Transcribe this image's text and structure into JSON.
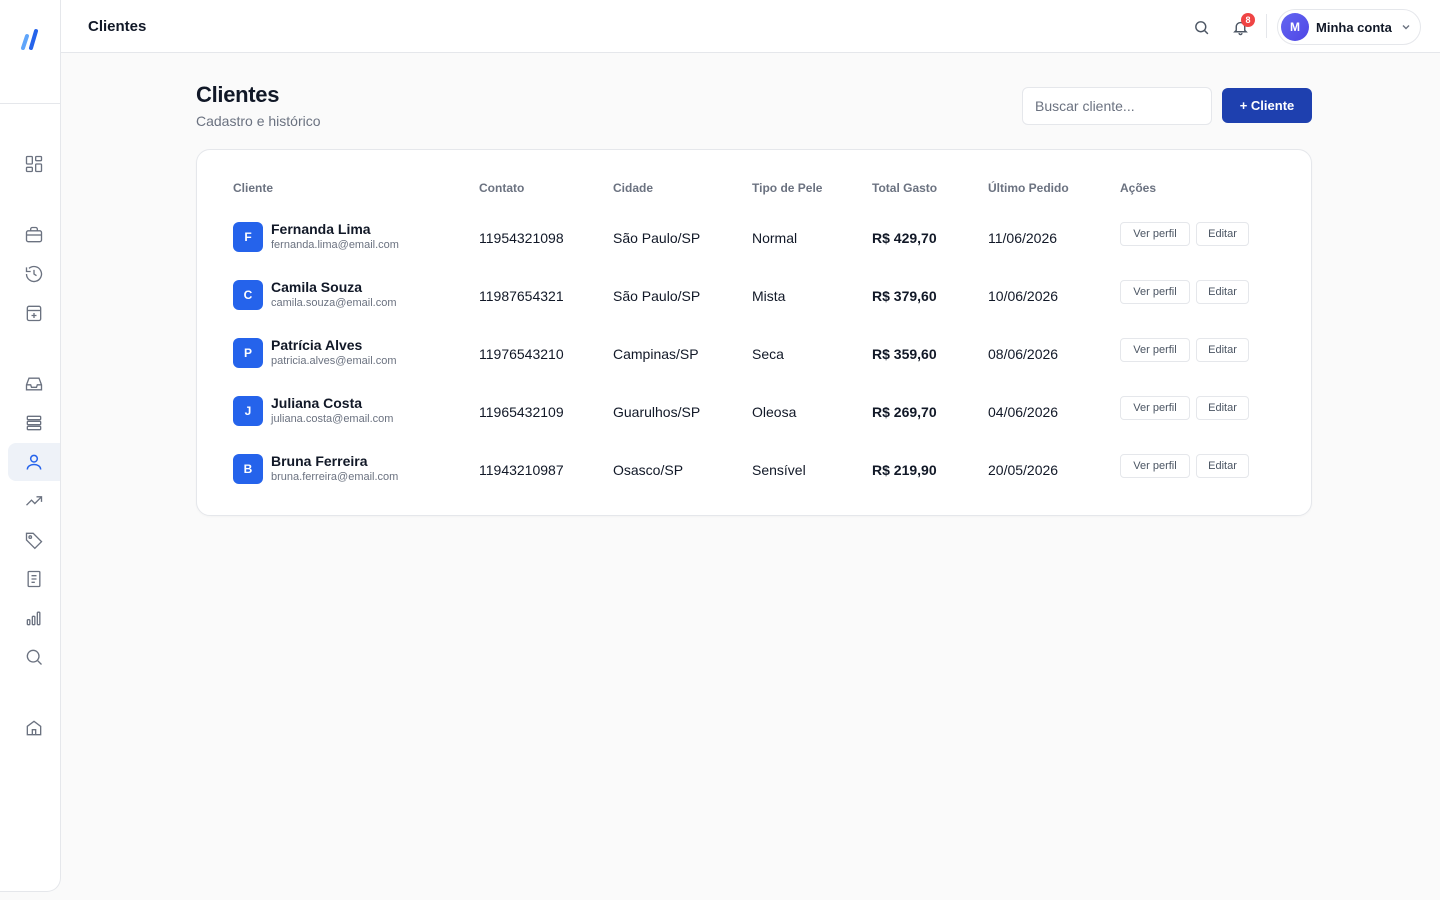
{
  "topbar": {
    "title": "Clientes",
    "notifications_count": "8",
    "account": {
      "initial": "M",
      "label": "Minha conta"
    }
  },
  "sidebar": {
    "logo": "logo-icon",
    "items": [
      {
        "icon": "dashboard-icon",
        "active": false
      },
      {
        "icon": "briefcase-icon",
        "active": false
      },
      {
        "icon": "history-icon",
        "active": false
      },
      {
        "icon": "archive-plus-icon",
        "active": false
      },
      {
        "icon": "inbox-icon",
        "active": false
      },
      {
        "icon": "layers-icon",
        "active": false
      },
      {
        "icon": "user-icon",
        "active": true
      },
      {
        "icon": "trending-up-icon",
        "active": false
      },
      {
        "icon": "tag-icon",
        "active": false
      },
      {
        "icon": "document-icon",
        "active": false
      },
      {
        "icon": "bar-chart-icon",
        "active": false
      },
      {
        "icon": "search-icon",
        "active": false
      },
      {
        "icon": "home-icon",
        "active": false
      }
    ]
  },
  "page": {
    "title": "Clientes",
    "subtitle": "Cadastro e histórico",
    "search_placeholder": "Buscar cliente...",
    "add_button": "+ Cliente"
  },
  "table": {
    "columns": [
      "Cliente",
      "Contato",
      "Cidade",
      "Tipo de Pele",
      "Total Gasto",
      "Último Pedido",
      "Ações"
    ],
    "view_label": "Ver perfil",
    "edit_label": "Editar",
    "rows": [
      {
        "initial": "F",
        "name": "Fernanda Lima",
        "email": "fernanda.lima@email.com",
        "contact": "11954321098",
        "city": "São Paulo/SP",
        "skin": "Normal",
        "total": "R$ 429,70",
        "last_order": "11/06/2026"
      },
      {
        "initial": "C",
        "name": "Camila Souza",
        "email": "camila.souza@email.com",
        "contact": "11987654321",
        "city": "São Paulo/SP",
        "skin": "Mista",
        "total": "R$ 379,60",
        "last_order": "10/06/2026"
      },
      {
        "initial": "P",
        "name": "Patrícia Alves",
        "email": "patricia.alves@email.com",
        "contact": "11976543210",
        "city": "Campinas/SP",
        "skin": "Seca",
        "total": "R$ 359,60",
        "last_order": "08/06/2026"
      },
      {
        "initial": "J",
        "name": "Juliana Costa",
        "email": "juliana.costa@email.com",
        "contact": "11965432109",
        "city": "Guarulhos/SP",
        "skin": "Oleosa",
        "total": "R$ 269,70",
        "last_order": "04/06/2026"
      },
      {
        "initial": "B",
        "name": "Bruna Ferreira",
        "email": "bruna.ferreira@email.com",
        "contact": "11943210987",
        "city": "Osasco/SP",
        "skin": "Sensível",
        "total": "R$ 219,90",
        "last_order": "20/05/2026"
      }
    ]
  },
  "colors": {
    "primary": "#1e40af",
    "avatar": "#2563eb",
    "badge": "#ef4444",
    "active_nav": "#eef2f8"
  }
}
